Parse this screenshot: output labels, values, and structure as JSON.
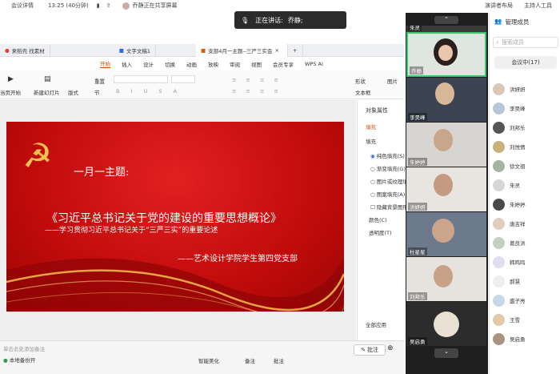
{
  "topbar": {
    "meeting_details": "会议详情",
    "clock": "13:25 (40分钟)",
    "sharing_status": "乔静正在共享屏幕",
    "layout_label": "演讲者布局",
    "host_label": "主持人工具"
  },
  "speaker": {
    "label": "正在讲话:",
    "name": "乔静;"
  },
  "browser_tabs": [
    {
      "label": "来稻壳 找素材"
    },
    {
      "label": "文字文稿1"
    },
    {
      "label": "支部4月一主题--三严三实会"
    }
  ],
  "menu": [
    "开始",
    "插入",
    "设计",
    "切换",
    "动画",
    "放映",
    "审阅",
    "视图",
    "会员专享",
    "WPS AI"
  ],
  "toolbar": {
    "play_from_current": "当页开始",
    "new_slide": "新建幻灯片",
    "layout": "版式",
    "section": "节",
    "reset": "重置",
    "shape": "形状",
    "picture": "图片",
    "textbox": "文本框"
  },
  "slide": {
    "heading": "一月一主题:",
    "title": "《习近平总书记关于党的建设的重要思想概论》",
    "subtitle": "——学习贯彻习近平总书记关于“三严三实”的重要论述",
    "author": "——艺术设计学院学生第四党支部"
  },
  "props": {
    "title": "对象属性",
    "fill_tab": "填充",
    "fill_section": "填充",
    "options": [
      "纯色填充(S)",
      "渐变填充(G)",
      "图片或纹理填充",
      "图案填充(A)",
      "隐藏背景图形"
    ],
    "color_label": "颜色(C)",
    "transparency_label": "透明度(T)",
    "apply_all": "全部应用"
  },
  "status": {
    "notes_hint": "单击此处添加备注",
    "backup": "本地备份开",
    "smart_beautify": "智能美化",
    "notes_btn": "备注",
    "annotate": "批注"
  },
  "float_annotate": "批注",
  "videos": [
    {
      "name": "朱灵"
    },
    {
      "name": "乔静"
    },
    {
      "name": "李昊峰"
    },
    {
      "name": "朱婷婷"
    },
    {
      "name": "洪妍妍"
    },
    {
      "name": "杜星星"
    },
    {
      "name": "刘邦乐"
    },
    {
      "name": "吴启勇"
    }
  ],
  "participants": {
    "title": "管理成员",
    "search_placeholder": "搜索成员",
    "tab": "会议中(17)",
    "list": [
      "洪妍妍",
      "李昊峰",
      "刘邦乐",
      "刘悦情",
      "徐文祖",
      "朱灵",
      "朱婷婷",
      "唐吉祥",
      "葛良洪",
      "韩鸣鸣",
      "郝慧",
      "盛子亮",
      "王雪",
      "吴启勇"
    ]
  },
  "colors": {
    "accent": "#d04b00",
    "slide_red": "#c10b0b",
    "slide_gold": "#f2c14e"
  }
}
